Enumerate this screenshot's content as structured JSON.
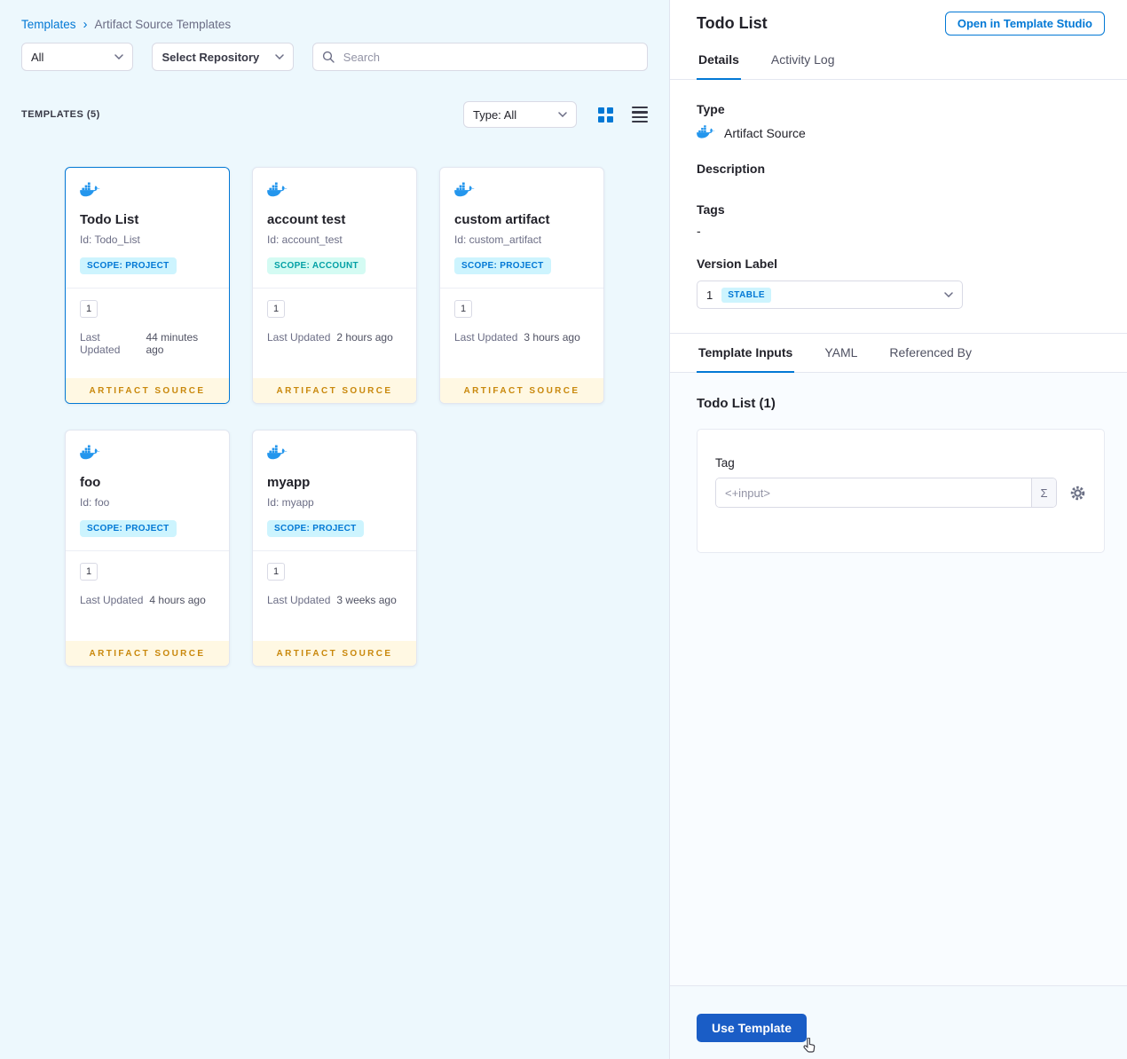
{
  "breadcrumb": {
    "root": "Templates",
    "separator": "›",
    "current": "Artifact Source Templates"
  },
  "filters": {
    "scope_filter_value": "All",
    "repository_filter_label": "Select Repository",
    "search_placeholder": "Search"
  },
  "list_header": {
    "count_label": "TEMPLATES (5)",
    "type_filter_value": "Type: All"
  },
  "labels": {
    "last_updated": "Last Updated"
  },
  "cards": [
    {
      "name": "Todo List",
      "id": "Id: Todo_List",
      "scope": "SCOPE: PROJECT",
      "scope_type": "project",
      "version": "1",
      "updated": "44 minutes ago",
      "footer": "ARTIFACT SOURCE",
      "selected": true
    },
    {
      "name": "account test",
      "id": "Id: account_test",
      "scope": "SCOPE: ACCOUNT",
      "scope_type": "account",
      "version": "1",
      "updated": "2 hours ago",
      "footer": "ARTIFACT SOURCE",
      "selected": false
    },
    {
      "name": "custom artifact",
      "id": "Id: custom_artifact",
      "scope": "SCOPE: PROJECT",
      "scope_type": "project",
      "version": "1",
      "updated": "3 hours ago",
      "footer": "ARTIFACT SOURCE",
      "selected": false
    },
    {
      "name": "foo",
      "id": "Id: foo",
      "scope": "SCOPE: PROJECT",
      "scope_type": "project",
      "version": "1",
      "updated": "4 hours ago",
      "footer": "ARTIFACT SOURCE",
      "selected": false
    },
    {
      "name": "myapp",
      "id": "Id: myapp",
      "scope": "SCOPE: PROJECT",
      "scope_type": "project",
      "version": "1",
      "updated": "3 weeks ago",
      "footer": "ARTIFACT SOURCE",
      "selected": false
    }
  ],
  "panel": {
    "title": "Todo List",
    "open_in_studio": "Open in Template Studio",
    "tabs": {
      "details": "Details",
      "activity_log": "Activity Log"
    },
    "details": {
      "type_label": "Type",
      "type_value": "Artifact Source",
      "description_label": "Description",
      "tags_label": "Tags",
      "tags_value": "-",
      "version_label": "Version Label",
      "version_value": "1",
      "version_badge": "STABLE"
    },
    "inner_tabs": {
      "template_inputs": "Template Inputs",
      "yaml": "YAML",
      "referenced_by": "Referenced By"
    },
    "inputs": {
      "section_title": "Todo List (1)",
      "tag_label": "Tag",
      "tag_placeholder": "<+input>",
      "expression_symbol": "Σ"
    },
    "use_template_label": "Use Template"
  },
  "colors": {
    "primary_blue": "#0278d5",
    "use_template_blue": "#1a5dc6",
    "artifact_source_gold": "#c9880c",
    "scope_project_bg": "#cdf4fe",
    "scope_account_bg": "#d4fbf3",
    "docker_blue": "#2496ed"
  }
}
